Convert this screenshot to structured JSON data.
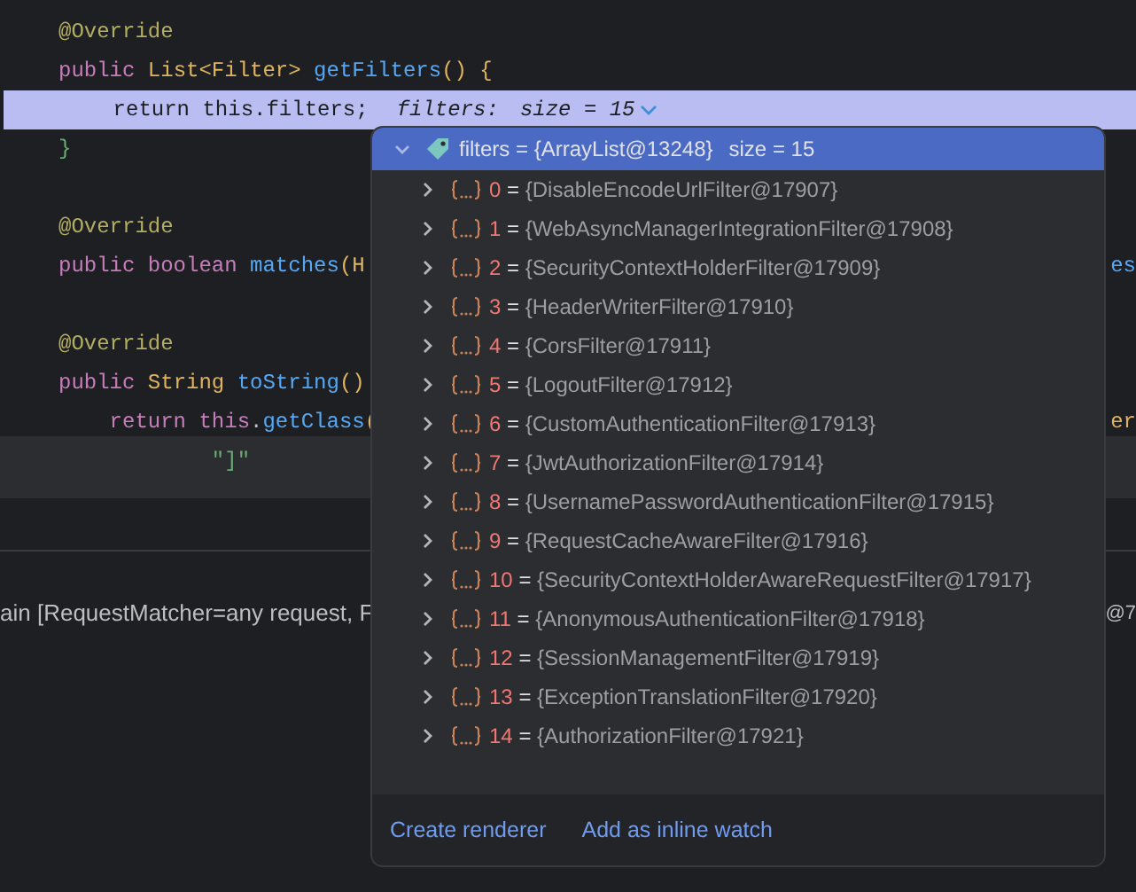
{
  "code_lines": [
    {
      "kind": "code",
      "tokens": [
        {
          "text": "@Override",
          "kind": "annotation"
        }
      ]
    },
    {
      "kind": "code",
      "tokens": [
        {
          "text": "public ",
          "kind": "keyword"
        },
        {
          "text": "List<Filter> ",
          "kind": "type"
        },
        {
          "text": "getFilters",
          "kind": "method"
        },
        {
          "text": "() {",
          "kind": "type"
        }
      ]
    },
    {
      "kind": "code",
      "tokens": [
        {
          "text": "    return this.filters;",
          "kind": "plain"
        }
      ],
      "highlighted": true,
      "hint": {
        "label": "filters:",
        "value": "size = 15"
      }
    },
    {
      "kind": "code",
      "tokens": [
        {
          "text": "}",
          "kind": "brace"
        }
      ]
    },
    {
      "kind": "blank"
    },
    {
      "kind": "code",
      "tokens": [
        {
          "text": "@Override",
          "kind": "annotation"
        }
      ]
    },
    {
      "kind": "code",
      "tokens": [
        {
          "text": "public boolean ",
          "kind": "keyword"
        },
        {
          "text": "matches",
          "kind": "method"
        },
        {
          "text": "(H",
          "kind": "type"
        }
      ],
      "right": {
        "text": "es",
        "kind": "method"
      }
    },
    {
      "kind": "blank"
    },
    {
      "kind": "code",
      "tokens": [
        {
          "text": "@Override",
          "kind": "annotation"
        }
      ]
    },
    {
      "kind": "code",
      "tokens": [
        {
          "text": "public ",
          "kind": "keyword"
        },
        {
          "text": "String ",
          "kind": "type"
        },
        {
          "text": "toString",
          "kind": "method"
        },
        {
          "text": "()",
          "kind": "type"
        }
      ]
    },
    {
      "kind": "code",
      "tokens": [
        {
          "text": "    return this",
          "kind": "keyword"
        },
        {
          "text": ".",
          "kind": "text"
        },
        {
          "text": "getClass",
          "kind": "method"
        },
        {
          "text": "(",
          "kind": "type"
        }
      ],
      "right": {
        "text": "er",
        "kind": "type"
      }
    },
    {
      "kind": "code",
      "tokens": [
        {
          "text": "            \"]\"",
          "kind": "string"
        }
      ]
    }
  ],
  "console": {
    "text": "ain [RequestMatcher=any request, F",
    "right": "@7"
  },
  "popup": {
    "header": {
      "text": "filters = {ArrayList@13248}",
      "size": "size = 15",
      "expanded": true,
      "selected": true
    },
    "separator": "=",
    "items": [
      {
        "index": "0",
        "value": "{DisableEncodeUrlFilter@17907}",
        "expanded": false
      },
      {
        "index": "1",
        "value": "{WebAsyncManagerIntegrationFilter@17908}",
        "expanded": false
      },
      {
        "index": "2",
        "value": "{SecurityContextHolderFilter@17909}",
        "expanded": false
      },
      {
        "index": "3",
        "value": "{HeaderWriterFilter@17910}",
        "expanded": false
      },
      {
        "index": "4",
        "value": "{CorsFilter@17911}",
        "expanded": false
      },
      {
        "index": "5",
        "value": "{LogoutFilter@17912}",
        "expanded": false
      },
      {
        "index": "6",
        "value": "{CustomAuthenticationFilter@17913}",
        "expanded": false
      },
      {
        "index": "7",
        "value": "{JwtAuthorizationFilter@17914}",
        "expanded": false
      },
      {
        "index": "8",
        "value": "{UsernamePasswordAuthenticationFilter@17915}",
        "expanded": false
      },
      {
        "index": "9",
        "value": "{RequestCacheAwareFilter@17916}",
        "expanded": false
      },
      {
        "index": "10",
        "value": "{SecurityContextHolderAwareRequestFilter@17917}",
        "expanded": false
      },
      {
        "index": "11",
        "value": "{AnonymousAuthenticationFilter@17918}",
        "expanded": false
      },
      {
        "index": "12",
        "value": "{SessionManagementFilter@17919}",
        "expanded": false
      },
      {
        "index": "13",
        "value": "{ExceptionTranslationFilter@17920}",
        "expanded": false
      },
      {
        "index": "14",
        "value": "{AuthorizationFilter@17921}",
        "expanded": false
      }
    ],
    "links": [
      "Create renderer",
      "Add as inline watch"
    ]
  }
}
